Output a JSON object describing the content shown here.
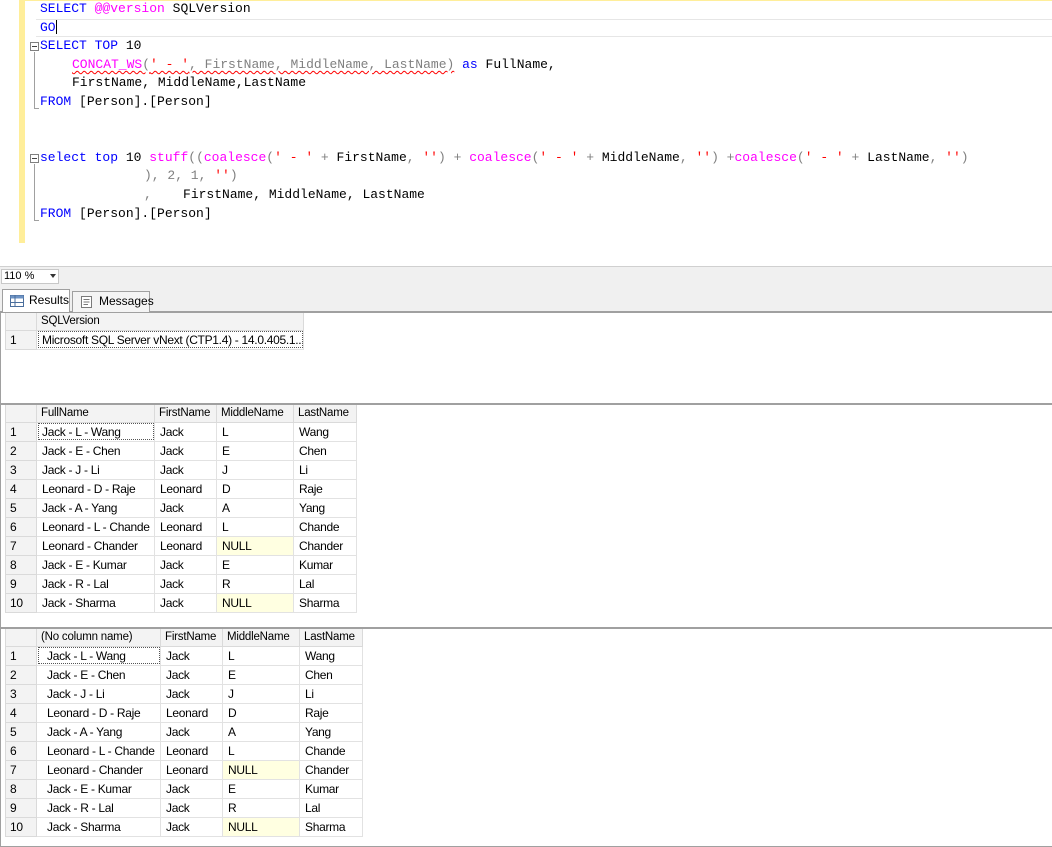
{
  "editor": {
    "lines": {
      "l1_kw": "SELECT",
      "l1_sys": "@@version",
      "l1_rest": " SQLVersion",
      "l2_kw": "GO",
      "l3_kw1": "SELECT",
      "l3_kw2": "TOP",
      "l3_num": " 10",
      "l4_fn": "CONCAT_WS",
      "l4_p1": "(",
      "l4_str": "' - '",
      "l4_p2": ", FirstName, MiddleName, LastName)",
      "l4_kw": "as",
      "l4_rest": " FullName,",
      "l5": "FirstName, MiddleName,LastName",
      "l6_kw": "FROM",
      "l6_rest": " [Person].[Person]",
      "l9_kw1": "select",
      "l9_kw2": "top",
      "l9_num": " 10 ",
      "l9_fn1": "stuff",
      "l9_p1": "((",
      "l9_fn2": "coalesce",
      "l9_p2": "(",
      "l9_s1": "' - '",
      "l9_op1": " + ",
      "l9_t1": "FirstName",
      "l9_p3": ", ",
      "l9_s2": "''",
      "l9_p4": ") + ",
      "l9_fn3": "coalesce",
      "l9_p5": "(",
      "l9_s3": "' - '",
      "l9_op2": " + ",
      "l9_t2": "MiddleName",
      "l9_p6": ", ",
      "l9_s4": "''",
      "l9_p7": ") +",
      "l9_fn4": "coalesce",
      "l9_p8": "(",
      "l9_s5": "' - '",
      "l9_op3": " + ",
      "l9_t3": "LastName",
      "l9_p9": ", ",
      "l9_s6": "''",
      "l9_p10": ")",
      "l10_p": "), 2, 1, ",
      "l10_s": "''",
      "l10_e": ")",
      "l11_c": ",",
      "l11_rest": "    FirstName, MiddleName, LastName",
      "l12_kw": "FROM",
      "l12_rest": " [Person].[Person]"
    }
  },
  "zoom": {
    "value": "110 %"
  },
  "tabs": {
    "results": "Results",
    "messages": "Messages"
  },
  "grid1": {
    "headers": [
      "SQLVersion"
    ],
    "rows": [
      [
        "1",
        "Microsoft SQL Server vNext (CTP1.4) - 14.0.405.1..."
      ]
    ]
  },
  "grid2": {
    "headers": [
      "FullName",
      "FirstName",
      "MiddleName",
      "LastName"
    ],
    "rows": [
      [
        "1",
        "Jack - L - Wang",
        "Jack",
        "L",
        "Wang"
      ],
      [
        "2",
        "Jack - E - Chen",
        "Jack",
        "E",
        "Chen"
      ],
      [
        "3",
        "Jack - J - Li",
        "Jack",
        "J",
        "Li"
      ],
      [
        "4",
        "Leonard - D - Raje",
        "Leonard",
        "D",
        "Raje"
      ],
      [
        "5",
        "Jack - A - Yang",
        "Jack",
        "A",
        "Yang"
      ],
      [
        "6",
        "Leonard - L - Chande",
        "Leonard",
        "L",
        "Chande"
      ],
      [
        "7",
        "Leonard - Chander",
        "Leonard",
        "NULL",
        "Chander"
      ],
      [
        "8",
        "Jack - E - Kumar",
        "Jack",
        "E",
        "Kumar"
      ],
      [
        "9",
        "Jack - R - Lal",
        "Jack",
        "R",
        "Lal"
      ],
      [
        "10",
        "Jack - Sharma",
        "Jack",
        "NULL",
        "Sharma"
      ]
    ]
  },
  "grid3": {
    "headers": [
      "(No column name)",
      "FirstName",
      "MiddleName",
      "LastName"
    ],
    "rows": [
      [
        "1",
        " Jack - L - Wang",
        "Jack",
        "L",
        "Wang"
      ],
      [
        "2",
        " Jack - E - Chen",
        "Jack",
        "E",
        "Chen"
      ],
      [
        "3",
        " Jack - J - Li",
        "Jack",
        "J",
        "Li"
      ],
      [
        "4",
        " Leonard - D - Raje",
        "Leonard",
        "D",
        "Raje"
      ],
      [
        "5",
        " Jack - A - Yang",
        "Jack",
        "A",
        "Yang"
      ],
      [
        "6",
        " Leonard - L - Chande",
        "Leonard",
        "L",
        "Chande"
      ],
      [
        "7",
        " Leonard - Chander",
        "Leonard",
        "NULL",
        "Chander"
      ],
      [
        "8",
        " Jack - E - Kumar",
        "Jack",
        "E",
        "Kumar"
      ],
      [
        "9",
        " Jack - R - Lal",
        "Jack",
        "R",
        "Lal"
      ],
      [
        "10",
        " Jack - Sharma",
        "Jack",
        "NULL",
        "Sharma"
      ]
    ]
  },
  "colors": {
    "keyword": "#0000ff",
    "function": "#ff00ff",
    "string": "#ff0000",
    "operator": "#808080",
    "null_cell": "#ffffe1"
  }
}
